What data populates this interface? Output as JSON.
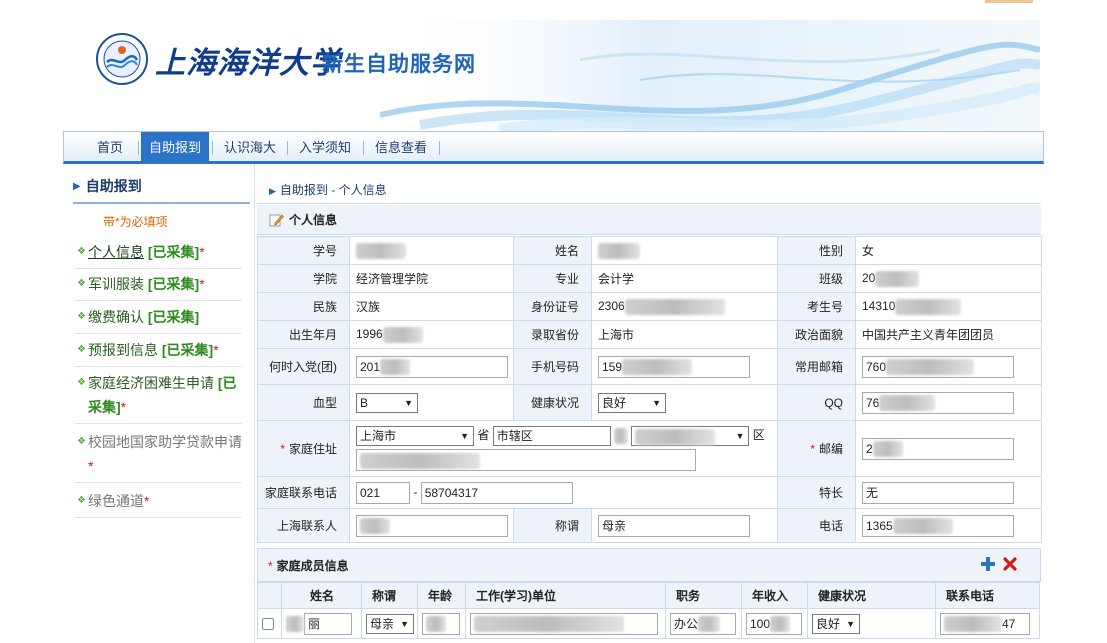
{
  "header": {
    "school_name": "上海海洋大学",
    "site_name": "新生自助服务网"
  },
  "nav": [
    {
      "label": "首页"
    },
    {
      "label": "自助报到"
    },
    {
      "label": "认识海大"
    },
    {
      "label": "入学须知"
    },
    {
      "label": "信息查看"
    }
  ],
  "sidebar": {
    "title": "自助报到",
    "required_note": "带*为必填项",
    "items": [
      {
        "name": "个人信息",
        "tag": "[已采集]",
        "star": "*"
      },
      {
        "name": "军训服装",
        "tag": "[已采集]",
        "star": "*"
      },
      {
        "name": "缴费确认",
        "tag": "[已采集]",
        "star": ""
      },
      {
        "name": "预报到信息",
        "tag": "[已采集]",
        "star": "*"
      },
      {
        "name": "家庭经济困难生申请",
        "tag": "[已采集]",
        "star": "*"
      },
      {
        "name": "校园地国家助学贷款申请",
        "tag": "",
        "star": "*"
      },
      {
        "name": "绿色通道",
        "tag": "",
        "star": "*"
      }
    ]
  },
  "breadcrumb": "自助报到 - 个人信息",
  "section_title": "个人信息",
  "info": {
    "labels": {
      "student_id": "学号",
      "name": "姓名",
      "gender": "性别",
      "college": "学院",
      "major": "专业",
      "class": "班级",
      "ethnicity": "民族",
      "id_number": "身份证号",
      "exam_no": "考生号",
      "birth": "出生年月",
      "admit_province": "录取省份",
      "political": "政治面貌",
      "join_party": "何时入党(团)",
      "mobile": "手机号码",
      "email": "常用邮箱",
      "blood": "血型",
      "health": "健康状况",
      "qq": "QQ",
      "home_addr": "家庭住址",
      "postcode": "邮编",
      "home_phone": "家庭联系电话",
      "specialty": "特长",
      "sh_contact": "上海联系人",
      "relation": "称谓",
      "phone": "电话"
    },
    "values": {
      "gender": "女",
      "college": "经济管理学院",
      "major": "会计学",
      "class": "20",
      "ethnicity": "汉族",
      "id_number": "2306",
      "exam_no": "14310",
      "birth": "1996",
      "admit_province": "上海市",
      "political": "中国共产主义青年团团员",
      "join_party": "201",
      "mobile": "159",
      "email": "760",
      "blood": "B",
      "health": "良好",
      "qq": "76",
      "province": "上海市",
      "province_unit": "省",
      "city": "市辖区",
      "district_unit": "区",
      "postcode": "2",
      "home_phone_area": "021",
      "home_phone_sep": "-",
      "home_phone_num": "58704317",
      "specialty": "无",
      "relation": "母亲",
      "phone": "1365"
    }
  },
  "family": {
    "title": "家庭成员信息",
    "headers": [
      "姓名",
      "称谓",
      "年龄",
      "工作(学习)单位",
      "职务",
      "年收入",
      "健康状况",
      "联系电话"
    ],
    "rows": [
      {
        "name": "丽",
        "relation": "母亲",
        "job": "办公",
        "income": "100",
        "health": "良好",
        "phone": "47"
      }
    ]
  }
}
